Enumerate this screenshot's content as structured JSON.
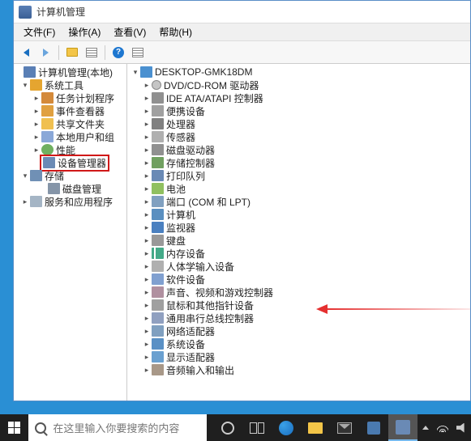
{
  "window": {
    "title": "计算机管理"
  },
  "menubar": {
    "file": "文件(F)",
    "action": "操作(A)",
    "view": "查看(V)",
    "help": "帮助(H)"
  },
  "left_tree": {
    "root": "计算机管理(本地)",
    "tools": "系统工具",
    "task": "任务计划程序",
    "event": "事件查看器",
    "share": "共享文件夹",
    "users": "本地用户和组",
    "perf": "性能",
    "devmgr": "设备管理器",
    "storage": "存储",
    "diskmgr": "磁盘管理",
    "services": "服务和应用程序"
  },
  "right_tree": {
    "host": "DESKTOP-GMK18DM",
    "items": [
      "DVD/CD-ROM 驱动器",
      "IDE ATA/ATAPI 控制器",
      "便携设备",
      "处理器",
      "传感器",
      "磁盘驱动器",
      "存储控制器",
      "打印队列",
      "电池",
      "端口 (COM 和 LPT)",
      "计算机",
      "监视器",
      "键盘",
      "内存设备",
      "人体学输入设备",
      "软件设备",
      "声音、视频和游戏控制器",
      "鼠标和其他指针设备",
      "通用串行总线控制器",
      "网络适配器",
      "系统设备",
      "显示适配器",
      "音频输入和输出"
    ]
  },
  "taskbar": {
    "search_placeholder": "在这里输入你要搜索的内容"
  }
}
